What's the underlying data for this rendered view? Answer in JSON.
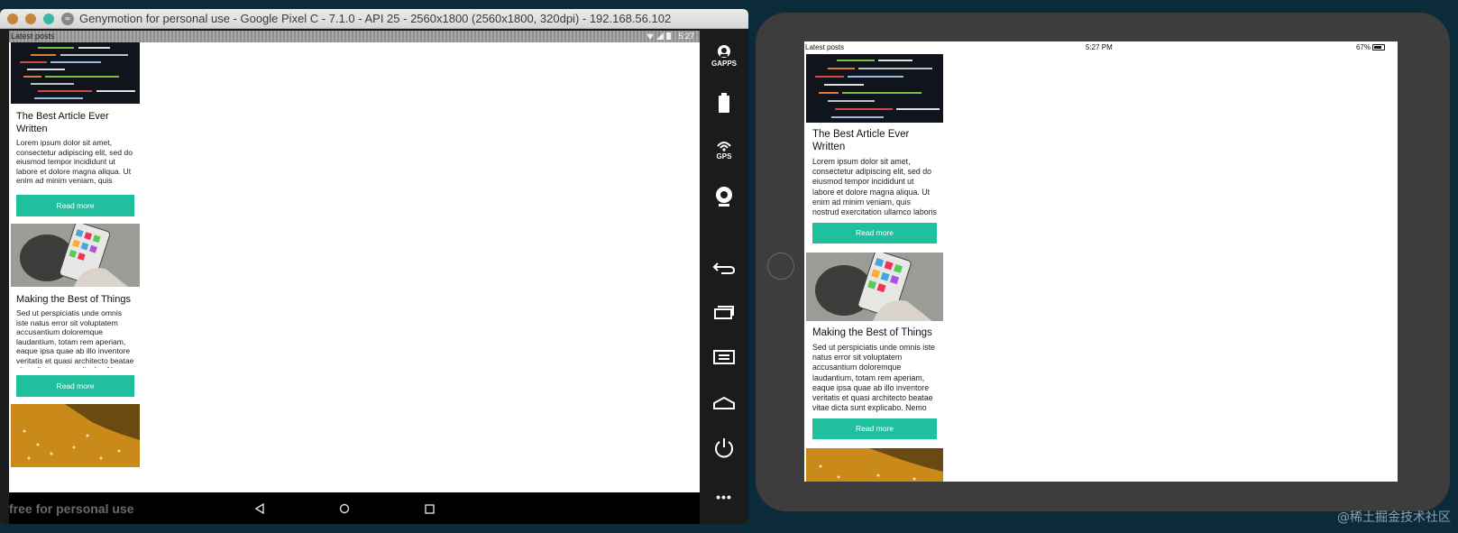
{
  "genymotion": {
    "window_title": "Genymotion for personal use - Google Pixel C - 7.1.0 - API 25 - 2560x1800 (2560x1800, 320dpi) - 192.168.56.102",
    "logo_glyph": "∞",
    "status_label": "Latest posts",
    "status_time": "5:27",
    "watermark": "free for personal use",
    "sidebar": [
      {
        "icon": "gapps-icon",
        "label": "GAPPS"
      },
      {
        "icon": "battery-icon",
        "label": ""
      },
      {
        "icon": "gps-icon",
        "label": "GPS"
      },
      {
        "icon": "webcam-icon",
        "label": ""
      },
      {
        "icon": "back-icon",
        "label": ""
      },
      {
        "icon": "recent-apps-icon",
        "label": ""
      },
      {
        "icon": "menu-icon",
        "label": ""
      },
      {
        "icon": "home-icon",
        "label": ""
      },
      {
        "icon": "power-icon",
        "label": ""
      },
      {
        "icon": "more-icon",
        "label": "•••"
      }
    ],
    "nav_icons": [
      "back-triangle-icon",
      "home-circle-icon",
      "overview-square-icon"
    ]
  },
  "posts": [
    {
      "title": "The Best Article Ever Written",
      "text": "Lorem ipsum dolor sit amet, consectetur adipiscing elit, sed do eiusmod tempor incididunt ut labore et dolore magna aliqua. Ut enim ad minim veniam, quis nostrud exercitation ullamco laboris",
      "button": "Read more"
    },
    {
      "title": "Making the Best of Things",
      "text": "Sed ut perspiciatis unde omnis iste natus error sit voluptatem accusantium doloremque laudantium, totam rem aperiam, eaque ipsa quae ab illo inventore veritatis et quasi architecto beatae vitae dicta sunt explicabo. Nemo enim",
      "button": "Read more"
    }
  ],
  "ipad": {
    "status_label": "Latest posts",
    "status_time": "5:27 PM",
    "battery": "67%"
  },
  "site_watermark": "@稀土掘金技术社区",
  "colors": {
    "accent": "#20bf9e",
    "code_bg": "#10141c",
    "orange_bg": "#c98a1a"
  }
}
